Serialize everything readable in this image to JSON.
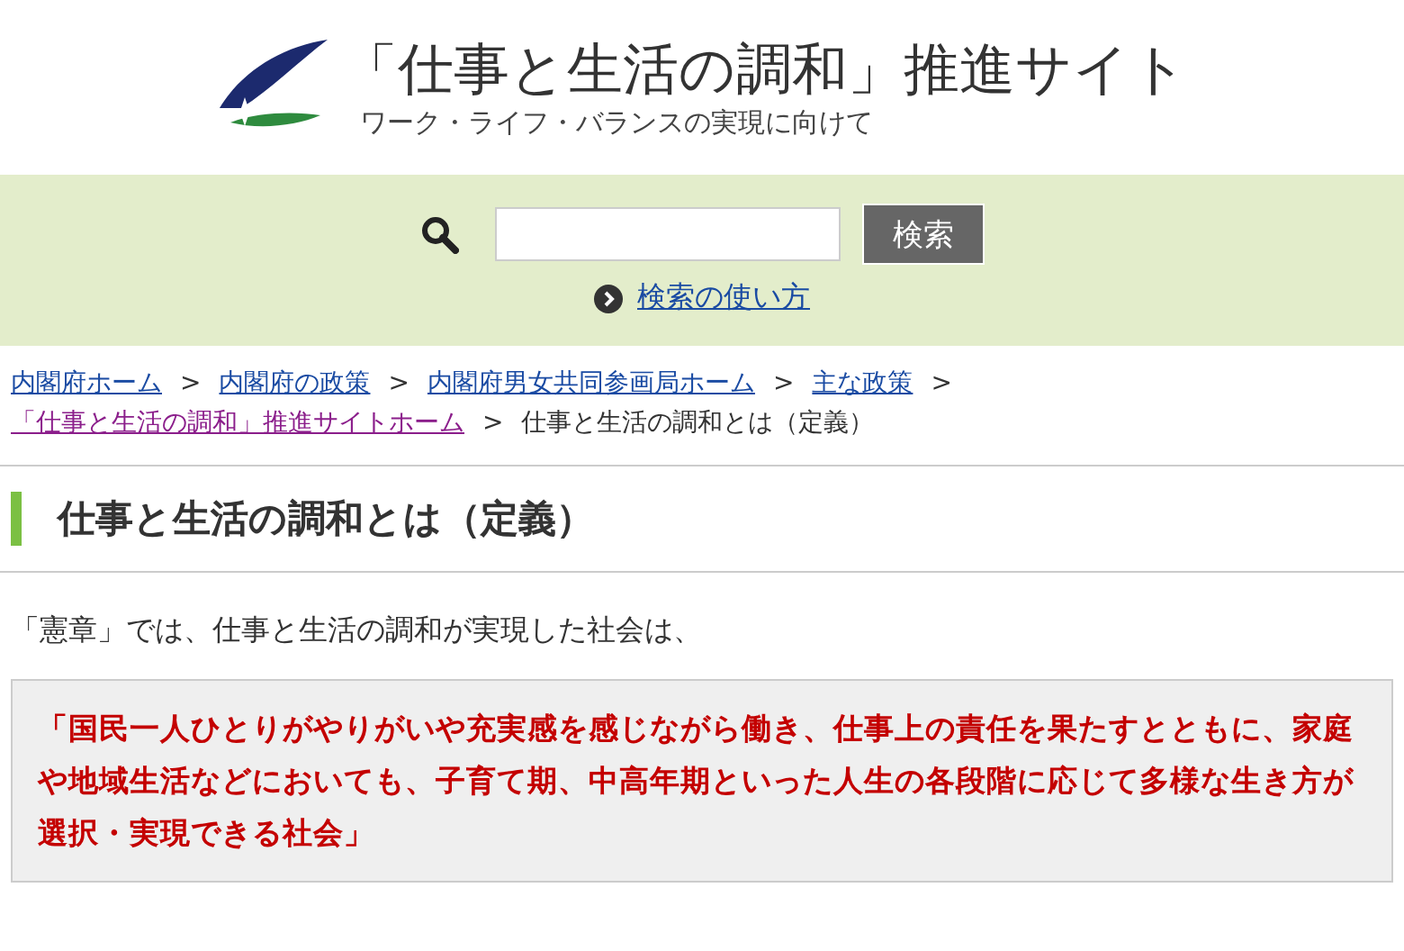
{
  "header": {
    "title": "「仕事と生活の調和」推進サイト",
    "subtitle": "ワーク・ライフ・バランスの実現に向けて"
  },
  "search": {
    "button": "検索",
    "help_link": "検索の使い方"
  },
  "breadcrumb": {
    "separator": ">",
    "links": [
      {
        "label": "内閣府ホーム",
        "visited": false
      },
      {
        "label": "内閣府の政策",
        "visited": false
      },
      {
        "label": "内閣府男女共同参画局ホーム",
        "visited": false
      },
      {
        "label": "主な政策",
        "visited": false
      },
      {
        "label": "「仕事と生活の調和」推進サイトホーム",
        "visited": true
      }
    ],
    "current": "仕事と生活の調和とは（定義）"
  },
  "heading": "仕事と生活の調和とは（定義）",
  "intro": "「憲章」では、仕事と生活の調和が実現した社会は、",
  "quote": "「国民一人ひとりがやりがいや充実感を感じながら働き、仕事上の責任を果たすとともに、家庭や地域生活などにおいても、子育て期、中高年期といった人生の各段階に応じて多様な生き方が選択・実現できる社会」"
}
